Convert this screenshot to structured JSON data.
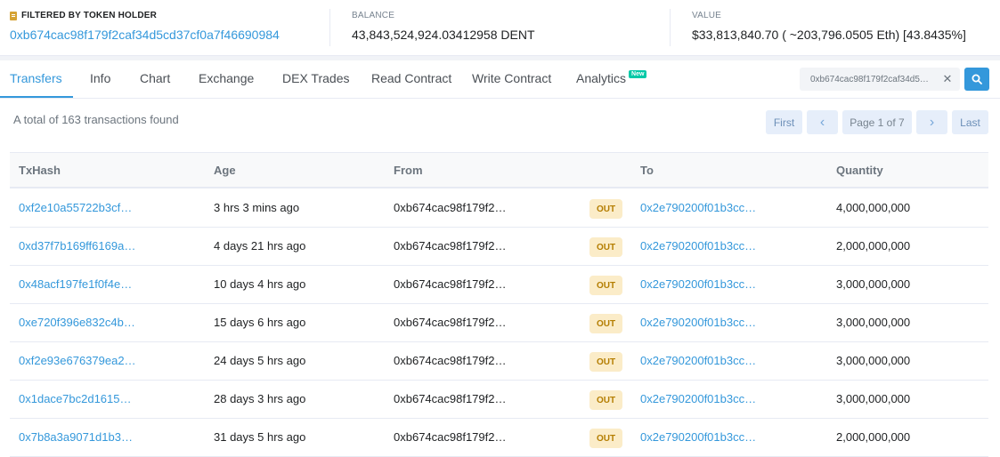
{
  "summary": {
    "filter_label": "FILTERED BY TOKEN HOLDER",
    "filter_address": "0xb674cac98f179f2caf34d5cd37cf0a7f46690984",
    "balance_label": "BALANCE",
    "balance_value": "43,843,524,924.03412958 DENT",
    "value_label": "VALUE",
    "value_value": "$33,813,840.70 ( ~203,796.0505 Eth) [43.8435%]"
  },
  "tabs": [
    {
      "label": "Transfers",
      "active": true
    },
    {
      "label": "Info"
    },
    {
      "label": "Chart"
    },
    {
      "label": "Exchange"
    },
    {
      "label": "DEX Trades"
    },
    {
      "label": "Read Contract"
    },
    {
      "label": "Write Contract"
    },
    {
      "label": "Analytics",
      "badge": "New"
    }
  ],
  "search": {
    "value": "0xb674cac98f179f2caf34d5…"
  },
  "total_text": "A total of 163 transactions found",
  "pagination": {
    "first": "First",
    "prev": "‹",
    "page": "Page 1 of 7",
    "next": "›",
    "last": "Last"
  },
  "table": {
    "headers": [
      "TxHash",
      "Age",
      "From",
      "To",
      "Quantity"
    ],
    "rows": [
      {
        "txhash": "0xf2e10a55722b3cf…",
        "age": "3 hrs 3 mins ago",
        "from": "0xb674cac98f179f2…",
        "dir": "OUT",
        "to": "0x2e790200f01b3cc…",
        "qty": "4,000,000,000"
      },
      {
        "txhash": "0xd37f7b169ff6169a…",
        "age": "4 days 21 hrs ago",
        "from": "0xb674cac98f179f2…",
        "dir": "OUT",
        "to": "0x2e790200f01b3cc…",
        "qty": "2,000,000,000"
      },
      {
        "txhash": "0x48acf197fe1f0f4e…",
        "age": "10 days 4 hrs ago",
        "from": "0xb674cac98f179f2…",
        "dir": "OUT",
        "to": "0x2e790200f01b3cc…",
        "qty": "3,000,000,000"
      },
      {
        "txhash": "0xe720f396e832c4b…",
        "age": "15 days 6 hrs ago",
        "from": "0xb674cac98f179f2…",
        "dir": "OUT",
        "to": "0x2e790200f01b3cc…",
        "qty": "3,000,000,000"
      },
      {
        "txhash": "0xf2e93e676379ea2…",
        "age": "24 days 5 hrs ago",
        "from": "0xb674cac98f179f2…",
        "dir": "OUT",
        "to": "0x2e790200f01b3cc…",
        "qty": "3,000,000,000"
      },
      {
        "txhash": "0x1dace7bc2d1615…",
        "age": "28 days 3 hrs ago",
        "from": "0xb674cac98f179f2…",
        "dir": "OUT",
        "to": "0x2e790200f01b3cc…",
        "qty": "3,000,000,000"
      },
      {
        "txhash": "0x7b8a3a9071d1b3…",
        "age": "31 days 5 hrs ago",
        "from": "0xb674cac98f179f2…",
        "dir": "OUT",
        "to": "0x2e790200f01b3cc…",
        "qty": "2,000,000,000"
      }
    ]
  },
  "colors": {
    "accent": "#3498db",
    "out_badge_bg": "#fbecc8",
    "out_badge_text": "#b47d00",
    "new_badge": "#00c9a7"
  },
  "icons": {
    "filter": "filter-holder-icon",
    "clear": "close-icon",
    "search": "search-icon"
  }
}
